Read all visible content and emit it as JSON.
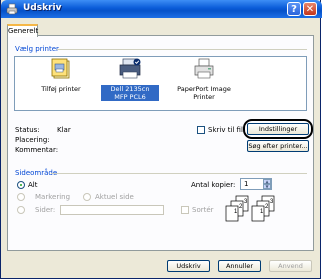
{
  "window": {
    "title": "Udskriv"
  },
  "tabs": [
    {
      "label": "Generelt"
    }
  ],
  "select_printer": {
    "label": "Vælg printer",
    "printers": [
      {
        "label": "Tilføj printer",
        "icon": "add-printer-icon",
        "selected": false
      },
      {
        "label": "Dell 2135cn MFP PCL6",
        "icon": "dell-printer-icon",
        "selected": true
      },
      {
        "label": "PaperPort Image Printer",
        "icon": "paperport-printer-icon",
        "selected": false
      }
    ]
  },
  "status": {
    "status_label": "Status:",
    "status_value": "Klar",
    "location_label": "Placering:",
    "comment_label": "Kommentar:",
    "print_to_file_label": "Skriv til fil",
    "preferences_button": "Indstillinger",
    "find_printer_button": "Søg efter printer..."
  },
  "page_range": {
    "label": "Sideområde",
    "all_label": "Alt",
    "selection_label": "Markering",
    "current_page_label": "Aktuel side",
    "pages_label": "Sider:"
  },
  "copies": {
    "label": "Antal kopier:",
    "value": "1",
    "collate_label": "Sortér"
  },
  "footer": {
    "print_button": "Udskriv",
    "cancel_button": "Annuller",
    "apply_button": "Anvend"
  }
}
